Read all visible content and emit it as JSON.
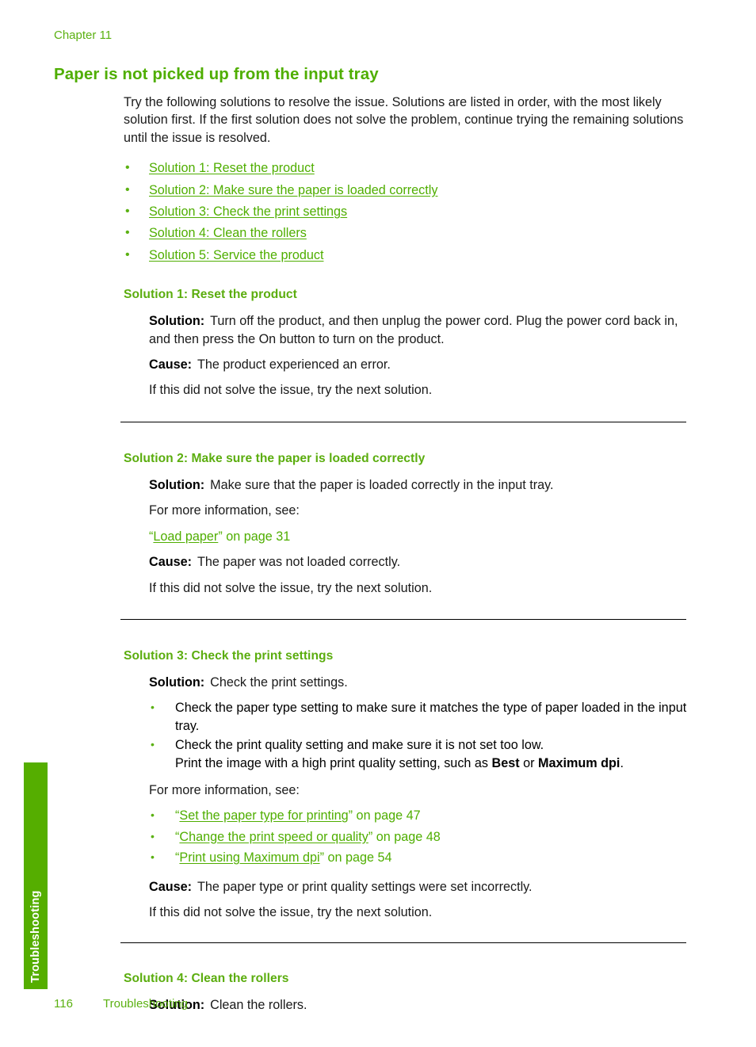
{
  "header": {
    "chapter": "Chapter 11"
  },
  "title": "Paper is not picked up from the input tray",
  "intro": "Try the following solutions to resolve the issue. Solutions are listed in order, with the most likely solution first. If the first solution does not solve the problem, continue trying the remaining solutions until the issue is resolved.",
  "bullet_glyph": "•",
  "toc_links": [
    {
      "label": "Solution 1: Reset the product"
    },
    {
      "label": "Solution 2: Make sure the paper is loaded correctly"
    },
    {
      "label": "Solution 3: Check the print settings"
    },
    {
      "label": "Solution 4: Clean the rollers"
    },
    {
      "label": "Solution 5: Service the product"
    }
  ],
  "labels": {
    "solution": "Solution:",
    "cause": "Cause:",
    "next_solution": "If this did not solve the issue, try the next solution.",
    "more_info": "For more information, see:"
  },
  "solution1": {
    "heading": "Solution 1: Reset the product",
    "solution_text": "Turn off the product, and then unplug the power cord. Plug the power cord back in, and then press the On button to turn on the product.",
    "cause_text": "The product experienced an error."
  },
  "solution2": {
    "heading": "Solution 2: Make sure the paper is loaded correctly",
    "solution_text": "Make sure that the paper is loaded correctly in the input tray.",
    "xref": {
      "quote_open": "“",
      "link": "Load paper",
      "quote_close": "”",
      "page_ref": " on page 31"
    },
    "cause_text": "The paper was not loaded correctly."
  },
  "solution3": {
    "heading": "Solution 3: Check the print settings",
    "solution_text": "Check the print settings.",
    "bullets": [
      {
        "text": "Check the paper type setting to make sure it matches the type of paper loaded in the input tray."
      }
    ],
    "bullet2": {
      "line1": "Check the print quality setting and make sure it is not set too low.",
      "line2_pre": "Print the image with a high print quality setting, such as ",
      "bold1": "Best",
      "line2_mid": " or ",
      "bold2": "Maximum dpi",
      "line2_post": "."
    },
    "xrefs": [
      {
        "quote_open": "“",
        "link": "Set the paper type for printing",
        "quote_close": "”",
        "page_ref": " on page 47"
      },
      {
        "quote_open": "“",
        "link": "Change the print speed or quality",
        "quote_close": "”",
        "page_ref": " on page 48"
      },
      {
        "quote_open": "“",
        "link": "Print using Maximum dpi",
        "quote_close": "”",
        "page_ref": " on page 54"
      }
    ],
    "cause_text": "The paper type or print quality settings were set incorrectly."
  },
  "solution4": {
    "heading": "Solution 4: Clean the rollers",
    "solution_text": "Clean the rollers."
  },
  "side_tab": {
    "label": "Troubleshooting"
  },
  "footer": {
    "page_number": "116",
    "section": "Troubleshooting"
  },
  "colors": {
    "accent_green": "#4FAE00",
    "header_green": "#5BB112",
    "tab_green": "#55AE00"
  }
}
